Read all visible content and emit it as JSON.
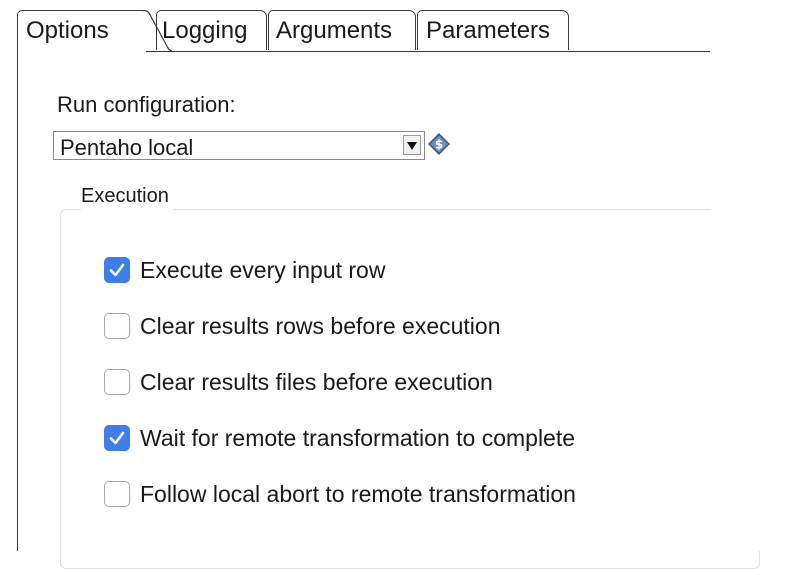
{
  "tabs": [
    {
      "label": "Options",
      "active": true
    },
    {
      "label": "Logging",
      "active": false
    },
    {
      "label": "Arguments",
      "active": false
    },
    {
      "label": "Parameters",
      "active": false
    }
  ],
  "run_configuration": {
    "label": "Run configuration:",
    "value": "Pentaho local",
    "variable_icon": "variable-dollar-icon"
  },
  "execution": {
    "title": "Execution",
    "options": [
      {
        "label": "Execute every input row",
        "checked": true
      },
      {
        "label": "Clear results rows before execution",
        "checked": false
      },
      {
        "label": "Clear results files before execution",
        "checked": false
      },
      {
        "label": "Wait for remote transformation to complete",
        "checked": true
      },
      {
        "label": "Follow local abort to remote transformation",
        "checked": false
      }
    ]
  },
  "colors": {
    "checkbox_checked": "#3d7ee8",
    "border": "#3a3a3a"
  }
}
